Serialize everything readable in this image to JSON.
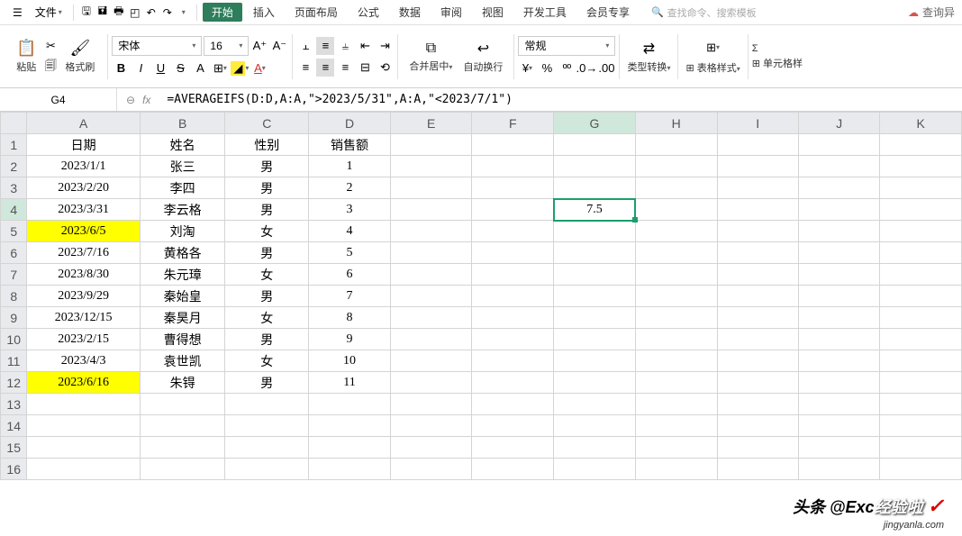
{
  "menubar": {
    "file": "文件",
    "tabs": [
      "开始",
      "插入",
      "页面布局",
      "公式",
      "数据",
      "审阅",
      "视图",
      "开发工具",
      "会员专享"
    ],
    "active_tab": 0,
    "search_placeholder": "查找命令、搜索模板",
    "right_label": "查询异"
  },
  "ribbon": {
    "paste": "粘贴",
    "format_painter": "格式刷",
    "font_name": "宋体",
    "font_size": "16",
    "merge": "合并居中",
    "wrap": "自动换行",
    "number_format": "常规",
    "type_convert": "类型转换",
    "table_style": "表格样式",
    "cell_style": "单元格样"
  },
  "formula_bar": {
    "cell_ref": "G4",
    "fx": "fx",
    "formula": "=AVERAGEIFS(D:D,A:A,\">2023/5/31\",A:A,\"<2023/7/1\")"
  },
  "columns": [
    "A",
    "B",
    "C",
    "D",
    "E",
    "F",
    "G",
    "H",
    "I",
    "J",
    "K"
  ],
  "headers": {
    "A": "日期",
    "B": "姓名",
    "C": "性别",
    "D": "销售额"
  },
  "rows": [
    {
      "n": 1
    },
    {
      "n": 2,
      "A": "2023/1/1",
      "B": "张三",
      "C": "男",
      "D": "1"
    },
    {
      "n": 3,
      "A": "2023/2/20",
      "B": "李四",
      "C": "男",
      "D": "2"
    },
    {
      "n": 4,
      "A": "2023/3/31",
      "B": "李云格",
      "C": "男",
      "D": "3",
      "G": "7.5"
    },
    {
      "n": 5,
      "A": "2023/6/5",
      "B": "刘淘",
      "C": "女",
      "D": "4",
      "hl": true
    },
    {
      "n": 6,
      "A": "2023/7/16",
      "B": "黄格各",
      "C": "男",
      "D": "5"
    },
    {
      "n": 7,
      "A": "2023/8/30",
      "B": "朱元璋",
      "C": "女",
      "D": "6"
    },
    {
      "n": 8,
      "A": "2023/9/29",
      "B": "秦始皇",
      "C": "男",
      "D": "7"
    },
    {
      "n": 9,
      "A": "2023/12/15",
      "B": "秦昊月",
      "C": "女",
      "D": "8"
    },
    {
      "n": 10,
      "A": "2023/2/15",
      "B": "曹得想",
      "C": "男",
      "D": "9"
    },
    {
      "n": 11,
      "A": "2023/4/3",
      "B": "袁世凯",
      "C": "女",
      "D": "10"
    },
    {
      "n": 12,
      "A": "2023/6/16",
      "B": "朱锝",
      "C": "男",
      "D": "11",
      "hl": true
    },
    {
      "n": 13
    },
    {
      "n": 14
    },
    {
      "n": 15
    },
    {
      "n": 16
    }
  ],
  "selected": {
    "row": 4,
    "col": "G"
  },
  "watermark": {
    "main": "头条 @Exc",
    "sub": "jingyanla.com",
    "brand": "经验啦"
  }
}
